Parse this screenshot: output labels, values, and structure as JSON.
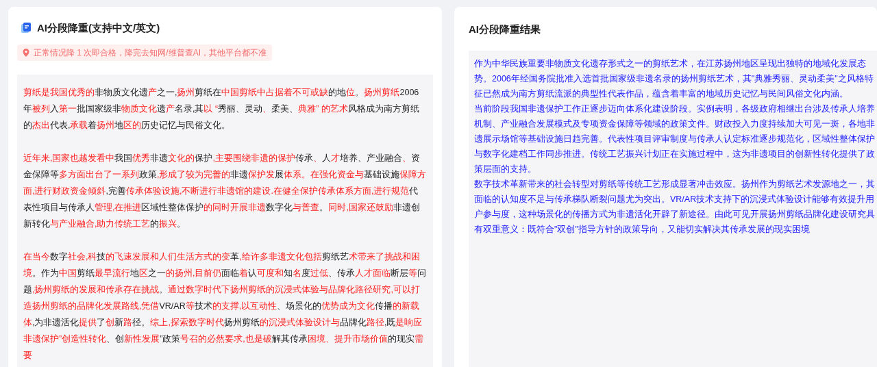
{
  "input_panel": {
    "title": "AI分段降重(支持中文/英文)",
    "notice": "正常情况降 1 次即合格，降完去知网/维普查AI，其他平台都不准",
    "paragraphs": [
      {
        "segments": [
          {
            "text": "剪纸是我国优秀的",
            "changed": true
          },
          {
            "text": "非物质文化遗",
            "changed": false
          },
          {
            "text": "产",
            "changed": true
          },
          {
            "text": "之一,",
            "changed": false
          },
          {
            "text": "扬州",
            "changed": true
          },
          {
            "text": "剪纸在",
            "changed": false
          },
          {
            "text": "中国剪纸中占据着不可或缺",
            "changed": true
          },
          {
            "text": "的地",
            "changed": false
          },
          {
            "text": "位",
            "changed": true
          },
          {
            "text": "。",
            "changed": false
          },
          {
            "text": "扬州剪纸",
            "changed": true
          },
          {
            "text": "2006 年",
            "changed": false
          },
          {
            "text": "被列",
            "changed": true
          },
          {
            "text": "入",
            "changed": false
          },
          {
            "text": "第一",
            "changed": true
          },
          {
            "text": "批国家级非",
            "changed": false
          },
          {
            "text": "物质文化",
            "changed": true
          },
          {
            "text": "遗",
            "changed": false
          },
          {
            "text": "产",
            "changed": true
          },
          {
            "text": "名录,其",
            "changed": false
          },
          {
            "text": "以 “",
            "changed": true
          },
          {
            "text": "秀丽、灵动",
            "changed": false
          },
          {
            "text": "、",
            "changed": true
          },
          {
            "text": "柔美、",
            "changed": false
          },
          {
            "text": "典雅” 的艺术",
            "changed": true
          },
          {
            "text": "风格成为南方剪纸的",
            "changed": false
          },
          {
            "text": "杰出",
            "changed": true
          },
          {
            "text": "代表,",
            "changed": false
          },
          {
            "text": "承载",
            "changed": true
          },
          {
            "text": "着",
            "changed": false
          },
          {
            "text": "扬州",
            "changed": true
          },
          {
            "text": "地",
            "changed": false
          },
          {
            "text": "区的",
            "changed": true
          },
          {
            "text": "历史记忆与民俗文化。",
            "changed": false
          }
        ]
      },
      {
        "segments": [
          {
            "text": "近年来,国家也越发看中",
            "changed": true
          },
          {
            "text": "我国",
            "changed": false
          },
          {
            "text": "优秀",
            "changed": true
          },
          {
            "text": "非遗",
            "changed": false
          },
          {
            "text": "文化的",
            "changed": true
          },
          {
            "text": "保护",
            "changed": false
          },
          {
            "text": ",主要围绕非遗的保护",
            "changed": true
          },
          {
            "text": "传承",
            "changed": false
          },
          {
            "text": "、",
            "changed": true
          },
          {
            "text": "人",
            "changed": false
          },
          {
            "text": "才",
            "changed": true
          },
          {
            "text": "培养、产业融合",
            "changed": false
          },
          {
            "text": "、",
            "changed": true
          },
          {
            "text": "资金保障等",
            "changed": false
          },
          {
            "text": "多方面出台了一系列",
            "changed": true
          },
          {
            "text": "政策",
            "changed": false
          },
          {
            "text": ",形成了较为完善的",
            "changed": true
          },
          {
            "text": "非遗",
            "changed": false
          },
          {
            "text": "保护发",
            "changed": true
          },
          {
            "text": "展",
            "changed": false
          },
          {
            "text": "体系。在强化资金与",
            "changed": true
          },
          {
            "text": "基础设施",
            "changed": false
          },
          {
            "text": "保障方面,进行财政资金倾斜",
            "changed": true
          },
          {
            "text": ",完善",
            "changed": false
          },
          {
            "text": "传承体验设施,不断进行非遗馆的建设.在健全保护传承体系方面,进行规范",
            "changed": true
          },
          {
            "text": "代表性项目与传承人",
            "changed": false
          },
          {
            "text": "管理,在推进",
            "changed": true
          },
          {
            "text": "区域性整体保护",
            "changed": false
          },
          {
            "text": "的同时开展非遗",
            "changed": true
          },
          {
            "text": "数字化",
            "changed": false
          },
          {
            "text": "与普查",
            "changed": true
          },
          {
            "text": "。",
            "changed": false
          },
          {
            "text": "同时,国家还鼓励",
            "changed": true
          },
          {
            "text": "非遗创新转化",
            "changed": false
          },
          {
            "text": "与产业融合,助力传统工艺",
            "changed": true
          },
          {
            "text": "的",
            "changed": false
          },
          {
            "text": "振兴",
            "changed": true
          },
          {
            "text": "。",
            "changed": false
          }
        ]
      },
      {
        "segments": [
          {
            "text": "在当今",
            "changed": true
          },
          {
            "text": "数字",
            "changed": false
          },
          {
            "text": "社会,科",
            "changed": true
          },
          {
            "text": "技",
            "changed": false
          },
          {
            "text": "的飞速发展和人们生活方式的变",
            "changed": true
          },
          {
            "text": "革",
            "changed": false
          },
          {
            "text": ",给许多非遗文化包括",
            "changed": true
          },
          {
            "text": "剪纸艺",
            "changed": false
          },
          {
            "text": "术带来了挑战和困境",
            "changed": true
          },
          {
            "text": "。作为",
            "changed": false
          },
          {
            "text": "中国",
            "changed": true
          },
          {
            "text": "剪纸",
            "changed": false
          },
          {
            "text": "最早流行",
            "changed": true
          },
          {
            "text": "地",
            "changed": false
          },
          {
            "text": "区",
            "changed": true
          },
          {
            "text": "之一",
            "changed": false
          },
          {
            "text": "的扬州,目前仍",
            "changed": true
          },
          {
            "text": "面临",
            "changed": false
          },
          {
            "text": "着",
            "changed": true
          },
          {
            "text": "认",
            "changed": false
          },
          {
            "text": "可度和",
            "changed": true
          },
          {
            "text": "知",
            "changed": false
          },
          {
            "text": "名",
            "changed": true
          },
          {
            "text": "度",
            "changed": false
          },
          {
            "text": "过低",
            "changed": true
          },
          {
            "text": "、传承",
            "changed": false
          },
          {
            "text": "人才面临",
            "changed": true
          },
          {
            "text": "断层",
            "changed": false
          },
          {
            "text": "等",
            "changed": true
          },
          {
            "text": "问题",
            "changed": false
          },
          {
            "text": ",扬州剪纸的发展和传承存在挑战",
            "changed": true
          },
          {
            "text": "。",
            "changed": false
          },
          {
            "text": "通过数字时代下扬州剪纸的沉浸式体验与品牌化路径研究,可以打造扬州剪纸的品牌化发展路线,凭借",
            "changed": true
          },
          {
            "text": "VR/AR",
            "changed": false
          },
          {
            "text": "等",
            "changed": true
          },
          {
            "text": "技术",
            "changed": false
          },
          {
            "text": "的支撑,以互动性",
            "changed": true
          },
          {
            "text": "、场景化的",
            "changed": false
          },
          {
            "text": "优势成为文化",
            "changed": true
          },
          {
            "text": "传播",
            "changed": false
          },
          {
            "text": "的新载体",
            "changed": true
          },
          {
            "text": ",为非遗活化",
            "changed": false
          },
          {
            "text": "提供",
            "changed": true
          },
          {
            "text": "了",
            "changed": false
          },
          {
            "text": "创",
            "changed": true
          },
          {
            "text": "新",
            "changed": false
          },
          {
            "text": "路",
            "changed": true
          },
          {
            "text": "径。",
            "changed": false
          },
          {
            "text": "综上,探索数字时代",
            "changed": true
          },
          {
            "text": "扬州剪纸",
            "changed": false
          },
          {
            "text": "的沉浸式体验设计与",
            "changed": true
          },
          {
            "text": "品牌化",
            "changed": false
          },
          {
            "text": "路径",
            "changed": true
          },
          {
            "text": ",既",
            "changed": false
          },
          {
            "text": "是响应非遗保护”创造性转化",
            "changed": true
          },
          {
            "text": "、创",
            "changed": false
          },
          {
            "text": "新性发展",
            "changed": true
          },
          {
            "text": "”政策",
            "changed": false
          },
          {
            "text": "号召的必然要求,也是破",
            "changed": true
          },
          {
            "text": "解其传承",
            "changed": false
          },
          {
            "text": "困境、提升市场价值",
            "changed": true
          },
          {
            "text": "的现实",
            "changed": false
          },
          {
            "text": "需要",
            "changed": true
          }
        ]
      }
    ]
  },
  "result_panel": {
    "title": "AI分段降重结果",
    "paragraphs": [
      "作为中华民族重要非物质文化遗存形式之一的剪纸艺术，在江苏扬州地区呈现出独特的地域化发展态势。2006年经国务院批准入选首批国家级非遗名录的扬州剪纸艺术，其\"典雅秀丽、灵动柔美\"之风格特征已然成为南方剪纸流派的典型性代表作品，蕴含着丰富的地域历史记忆与民间风俗文化内涵。",
      "当前阶段我国非遗保护工作正逐步迈向体系化建设阶段。实例表明，各级政府相继出台涉及传承人培养机制、产业融合发展模式及专项资金保障等领域的政策文件。财政投入力度持续加大可见一斑，各地非遗展示场馆等基础设施日趋完善。代表性项目评审制度与传承人认定标准逐步规范化，区域性整体保护与数字化建档工作同步推进。传统工艺振兴计划正在实施过程中，这为非遗项目的创新性转化提供了政策层面的支持。",
      "数字技术革新带来的社会转型对剪纸等传统工艺形成显著冲击效应。扬州作为剪纸艺术发源地之一，其面临的认知度不足与传承梯队断裂问题尤为突出。VR/AR技术支持下的沉浸式体验设计能够有效提升用户参与度，这种场景化的传播方式为非遗活化开辟了新途径。由此可见开展扬州剪纸品牌化建设研究具有双重意义：既符合\"双创\"指导方针的政策导向，又能切实解决其传承发展的现实困境"
    ]
  }
}
